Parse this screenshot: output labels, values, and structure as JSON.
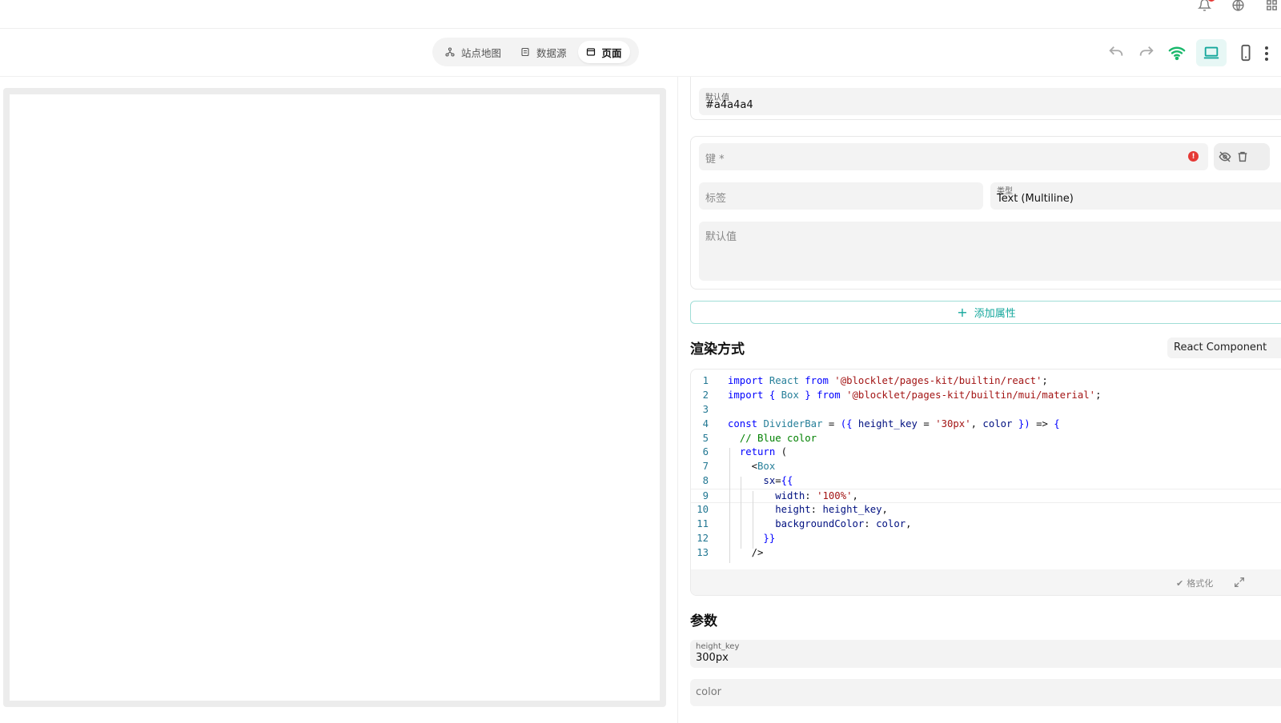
{
  "toolbar": {
    "tabs": [
      {
        "label": "站点地图",
        "icon": "sitemap-icon"
      },
      {
        "label": "数据源",
        "icon": "database-icon"
      },
      {
        "label": "页面",
        "icon": "page-icon",
        "active": true
      }
    ]
  },
  "panel": {
    "prev_default": {
      "label": "默认值",
      "value": "#a4a4a4"
    },
    "prop": {
      "key_label": "键 *",
      "label_placeholder": "标签",
      "type_label": "类型",
      "type_value": "Text (Multiline)",
      "default_placeholder": "默认值"
    },
    "add_property": "添加属性",
    "render_title": "渲染方式",
    "render_mode": "React Component",
    "code_lines": [
      "import React from '@blocklet/pages-kit/builtin/react';",
      "import { Box } from '@blocklet/pages-kit/builtin/mui/material';",
      "",
      "const DividerBar = ({ height_key = '30px', color }) => {",
      "  // Blue color",
      "  return (",
      "    <Box",
      "      sx={{",
      "        width: '100%',",
      "        height: height_key,",
      "        backgroundColor: color,",
      "      }}",
      "    />"
    ],
    "format_label": "格式化",
    "params_title": "参数",
    "params": [
      {
        "label": "height_key",
        "value": "300px"
      },
      {
        "label": "color",
        "value": ""
      }
    ]
  },
  "colors": {
    "accent": "#14a79c",
    "error": "#e53935",
    "online": "#19b86b"
  }
}
